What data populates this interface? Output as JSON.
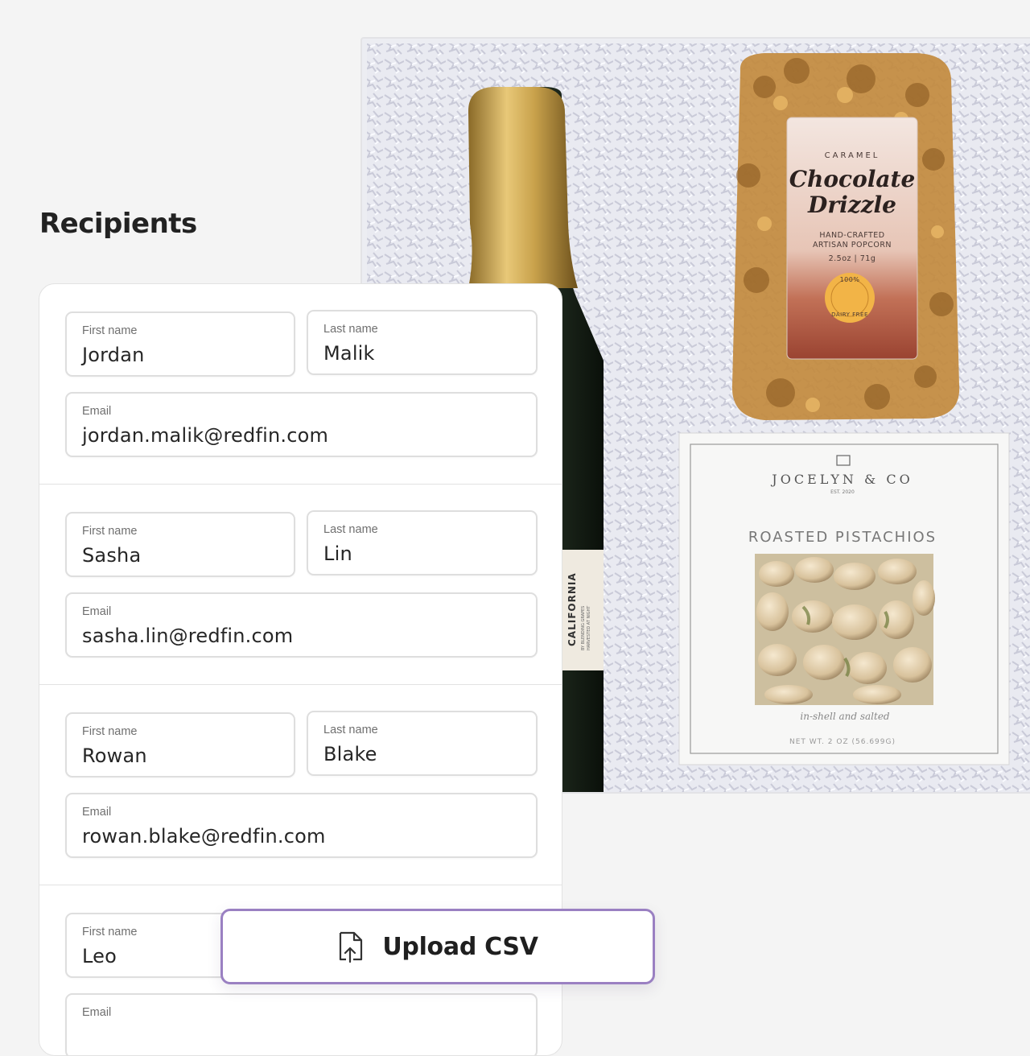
{
  "heading": "Recipients",
  "recipients": [
    {
      "first_label": "First name",
      "first": "Jordan",
      "last_label": "Last name",
      "last": "Malik",
      "email_label": "Email",
      "email": "jordan.malik@redfin.com"
    },
    {
      "first_label": "First name",
      "first": "Sasha",
      "last_label": "Last name",
      "last": "Lin",
      "email_label": "Email",
      "email": "sasha.lin@redfin.com"
    },
    {
      "first_label": "First name",
      "first": "Rowan",
      "last_label": "Last name",
      "last": "Blake",
      "email_label": "Email",
      "email": "rowan.blake@redfin.com"
    },
    {
      "first_label": "First name",
      "first": "Leo",
      "email_label": "Email"
    }
  ],
  "upload": {
    "label": "Upload CSV",
    "icon": "file-upload-icon",
    "border_color": "#9a80c2"
  },
  "gift_photo": {
    "popcorn": {
      "line1": "CARAMEL",
      "line2a": "Chocolate",
      "line2b": "Drizzle",
      "line3": "HAND-CRAFTED",
      "line4": "ARTISAN POPCORN",
      "weight": "2.5oz | 71g",
      "badge_top": "100%",
      "badge_bottom": "DAIRY FREE"
    },
    "pistachios": {
      "brand": "JOCELYN & CO",
      "est": "EST. 2020",
      "title": "ROASTED PISTACHIOS",
      "tagline": "in-shell and salted",
      "net": "NET WT. 2 OZ (56.699G)"
    },
    "bottle": {
      "label": "CALIFORNIA",
      "small1": "BY BLENDING GRAPES",
      "small2": "HARVESTED AT NIGHT"
    }
  }
}
